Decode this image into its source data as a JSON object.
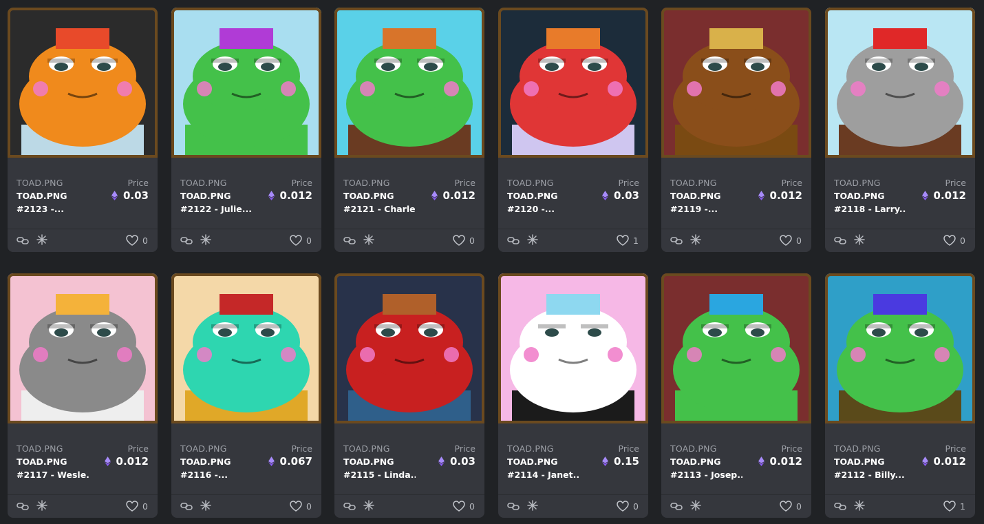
{
  "gallery": {
    "price_label": "Price",
    "currency_icon": "ethereum-icon",
    "accent_color": "#8b5cf6",
    "cards": [
      {
        "collection": "TOAD.PNG",
        "name_line1": "TOAD.PNG",
        "name_line2": "#2123 -...",
        "price": "0.03",
        "likes": "0",
        "art": {
          "bg": "#2b2b2b",
          "skin": "#f08a1c",
          "accent": "#e84a2a",
          "garment": "#bcd9e6"
        }
      },
      {
        "collection": "TOAD.PNG",
        "name_line1": "TOAD.PNG",
        "name_line2": "#2122 - Julie...",
        "price": "0.012",
        "likes": "0",
        "art": {
          "bg": "#a9def0",
          "skin": "#44c14a",
          "accent": "#b03bd6",
          "garment": "#44c14a"
        }
      },
      {
        "collection": "TOAD.PNG",
        "name_line1": "TOAD.PNG",
        "name_line2": "#2121 - Charle...",
        "price": "0.012",
        "likes": "0",
        "art": {
          "bg": "#5ad1e8",
          "skin": "#44c14a",
          "accent": "#d8742a",
          "garment": "#6a3b22"
        }
      },
      {
        "collection": "TOAD.PNG",
        "name_line1": "TOAD.PNG",
        "name_line2": "#2120 -...",
        "price": "0.03",
        "likes": "1",
        "art": {
          "bg": "#1c2c3a",
          "skin": "#e03636",
          "accent": "#e87b2a",
          "garment": "#cfc6f0"
        }
      },
      {
        "collection": "TOAD.PNG",
        "name_line1": "TOAD.PNG",
        "name_line2": "#2119 -...",
        "price": "0.012",
        "likes": "0",
        "art": {
          "bg": "#7a2e2e",
          "skin": "#8a4e1a",
          "accent": "#d9b14a",
          "garment": "#7a4a12"
        }
      },
      {
        "collection": "TOAD.PNG",
        "name_line1": "TOAD.PNG",
        "name_line2": "#2118 - Larry...",
        "price": "0.012",
        "likes": "0",
        "art": {
          "bg": "#b9e6f3",
          "skin": "#9e9e9e",
          "accent": "#e02828",
          "garment": "#6a3b22"
        }
      },
      {
        "collection": "TOAD.PNG",
        "name_line1": "TOAD.PNG",
        "name_line2": "#2117 - Wesle...",
        "price": "0.012",
        "likes": "0",
        "art": {
          "bg": "#f4c2d2",
          "skin": "#8a8a8a",
          "accent": "#f4b23a",
          "garment": "#eeeeee"
        }
      },
      {
        "collection": "TOAD.PNG",
        "name_line1": "TOAD.PNG",
        "name_line2": "#2116 -...",
        "price": "0.067",
        "likes": "0",
        "art": {
          "bg": "#f4d8a8",
          "skin": "#2ed6b0",
          "accent": "#c52828",
          "garment": "#e0a828"
        }
      },
      {
        "collection": "TOAD.PNG",
        "name_line1": "TOAD.PNG",
        "name_line2": "#2115 - Linda...",
        "price": "0.03",
        "likes": "0",
        "art": {
          "bg": "#28324a",
          "skin": "#c82020",
          "accent": "#b0602a",
          "garment": "#2f5f8a"
        }
      },
      {
        "collection": "TOAD.PNG",
        "name_line1": "TOAD.PNG",
        "name_line2": "#2114 - Janet...",
        "price": "0.15",
        "likes": "0",
        "art": {
          "bg": "#f6b8e6",
          "skin": "#ffffff",
          "accent": "#8ed8f0",
          "garment": "#1b1b1b"
        }
      },
      {
        "collection": "TOAD.PNG",
        "name_line1": "TOAD.PNG",
        "name_line2": "#2113 - Josep...",
        "price": "0.012",
        "likes": "0",
        "art": {
          "bg": "#7a2e2e",
          "skin": "#44c14a",
          "accent": "#2aa6e0",
          "garment": "#44c14a"
        }
      },
      {
        "collection": "TOAD.PNG",
        "name_line1": "TOAD.PNG",
        "name_line2": "#2112 - Billy...",
        "price": "0.012",
        "likes": "1",
        "art": {
          "bg": "#2f9fc8",
          "skin": "#44c14a",
          "accent": "#4a3ae0",
          "garment": "#5a4a1a"
        }
      }
    ]
  }
}
